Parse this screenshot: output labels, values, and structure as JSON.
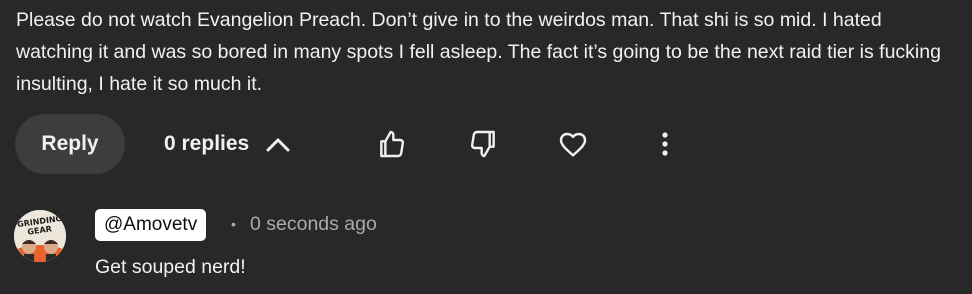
{
  "comment": {
    "text": "Please do not watch Evangelion Preach. Don’t give in to the weirdos man. That shi is so mid. I hated watching it and was so bored in many spots I fell asleep. The fact it’s going to be the next raid tier is fucking insulting, I hate it so much it."
  },
  "actions": {
    "reply_label": "Reply",
    "replies_label": "0 replies",
    "icons": [
      "chevron-up-icon",
      "thumbs-up-icon",
      "thumbs-down-icon",
      "heart-icon",
      "more-vertical-icon"
    ]
  },
  "reply": {
    "avatar_text_line1": "GRINDING",
    "avatar_text_line2": "GEAR",
    "username": "@Amovetv",
    "separator": "•",
    "timestamp": "0 seconds ago",
    "text": "Get souped nerd!"
  },
  "colors": {
    "background": "#282828",
    "text_primary": "#f1f1f1",
    "text_secondary": "#aaaaaa",
    "reply_button_bg": "#3d3d3d",
    "username_chip_bg": "#ffffff",
    "avatar_accent": "#e8632b"
  }
}
